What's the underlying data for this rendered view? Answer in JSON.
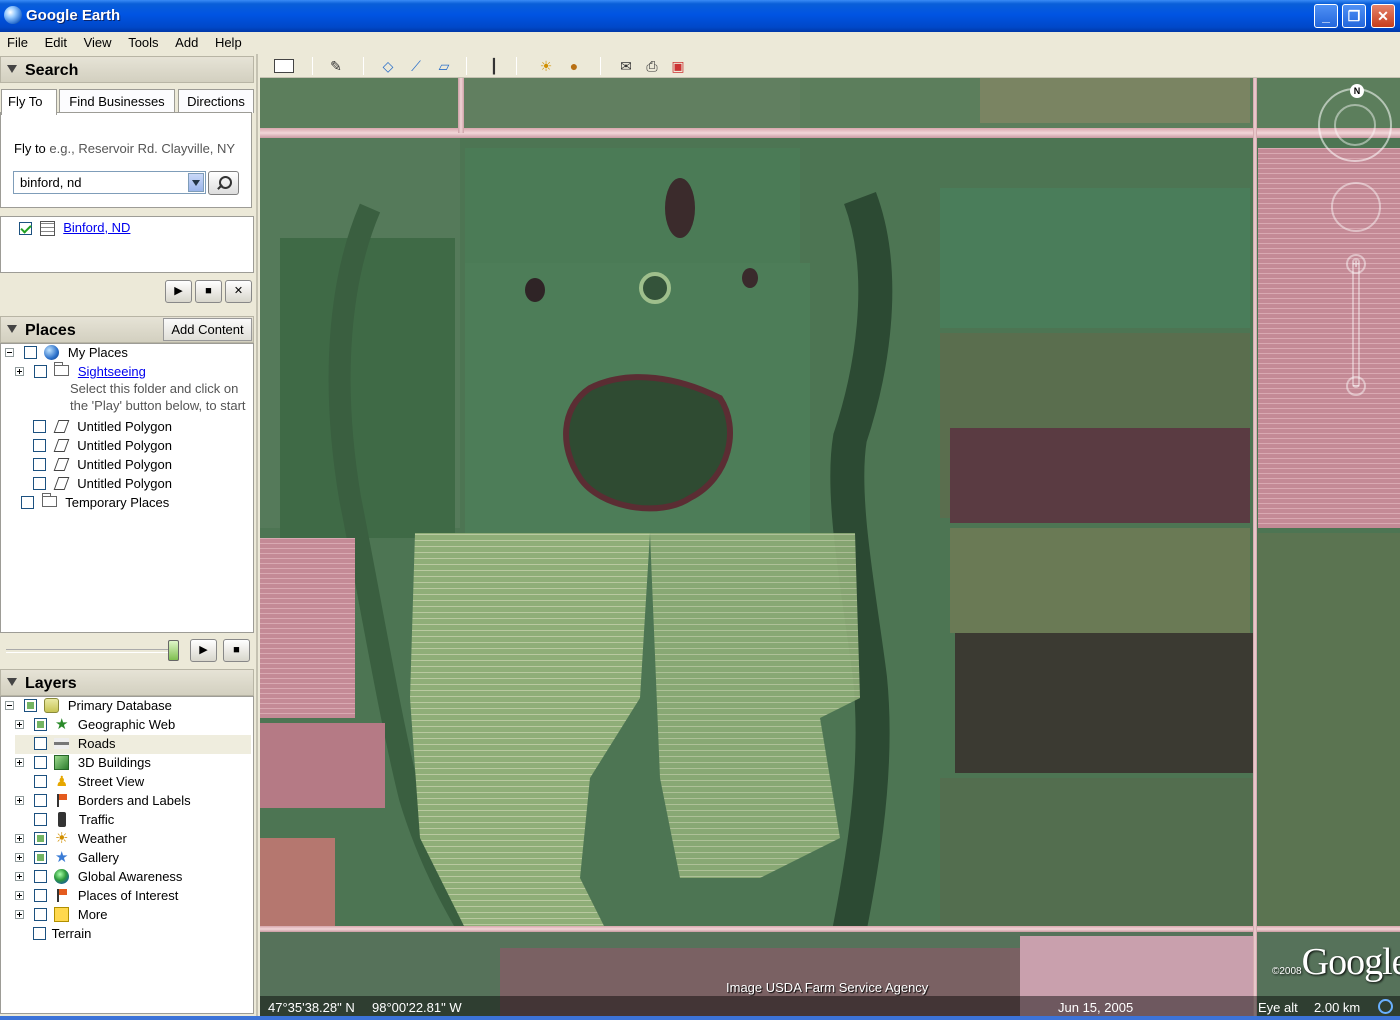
{
  "window": {
    "title": "Google Earth",
    "minimize": "_",
    "maximize": "❐",
    "close": "✕"
  },
  "menu": [
    "File",
    "Edit",
    "View",
    "Tools",
    "Add",
    "Help"
  ],
  "search": {
    "heading": "Search",
    "tabs": [
      "Fly To",
      "Find Businesses",
      "Directions"
    ],
    "hint_label": "Fly to",
    "hint_example": "e.g., Reservoir Rd. Clayville, NY",
    "input_value": "binford, nd",
    "result": "Binford, ND"
  },
  "places": {
    "heading": "Places",
    "add_content": "Add Content",
    "items": {
      "my_places": "My Places",
      "sightseeing": "Sightseeing",
      "sightseeing_desc1": "Select this folder and click on",
      "sightseeing_desc2": "the 'Play' button below, to start",
      "poly1": "Untitled Polygon",
      "poly2": "Untitled Polygon",
      "poly3": "Untitled Polygon",
      "poly4": "Untitled Polygon",
      "temporary": "Temporary Places"
    }
  },
  "layers": {
    "heading": "Layers",
    "items": {
      "primary": "Primary Database",
      "geoweb": "Geographic Web",
      "roads": "Roads",
      "buildings": "3D Buildings",
      "streetview": "Street View",
      "borders": "Borders and Labels",
      "traffic": "Traffic",
      "weather": "Weather",
      "gallery": "Gallery",
      "global": "Global Awareness",
      "poi": "Places of Interest",
      "more": "More",
      "terrain": "Terrain"
    }
  },
  "map": {
    "attribution": "Image USDA Farm Service Agency",
    "logo": "Google",
    "copyright": "©2008",
    "north": "N",
    "lat": "47°35'38.28\" N",
    "lon": "98°00'22.81\" W",
    "date": "Jun 15, 2005",
    "eye_label": "Eye alt",
    "eye_value": "2.00 km"
  },
  "colors": {
    "title_bar": "#0054e3",
    "panel_bg": "#ece9d8",
    "map_green": "#4f7a55",
    "field_pink": "#c48a96",
    "road": "#f0d4d6"
  }
}
